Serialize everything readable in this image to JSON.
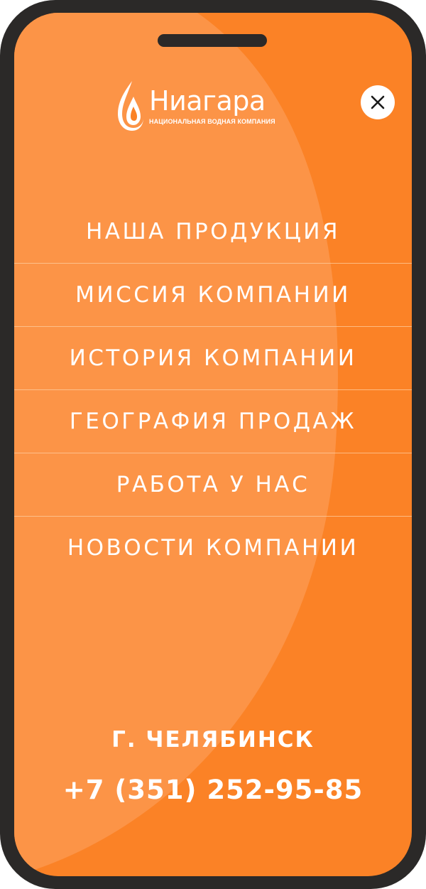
{
  "brand": {
    "name": "Ниагара",
    "tagline": "НАЦИОНАЛЬНАЯ ВОДНАЯ КОМПАНИЯ"
  },
  "menu": {
    "items": [
      {
        "label": "НАША ПРОДУКЦИЯ"
      },
      {
        "label": "МИССИЯ КОМПАНИИ"
      },
      {
        "label": "ИСТОРИЯ КОМПАНИИ"
      },
      {
        "label": "ГЕОГРАФИЯ ПРОДАЖ"
      },
      {
        "label": "РАБОТА У НАС"
      },
      {
        "label": "НОВОСТИ КОМПАНИИ"
      }
    ]
  },
  "contact": {
    "city": "Г. ЧЕЛЯБИНСК",
    "phone": "+7 (351) 252-95-85"
  },
  "icons": {
    "logo": "flame-drop-icon",
    "close": "close-icon"
  },
  "colors": {
    "background": "#fb8226",
    "background_light": "#fc9447",
    "text": "#ffffff",
    "device_frame": "#2b2928"
  }
}
